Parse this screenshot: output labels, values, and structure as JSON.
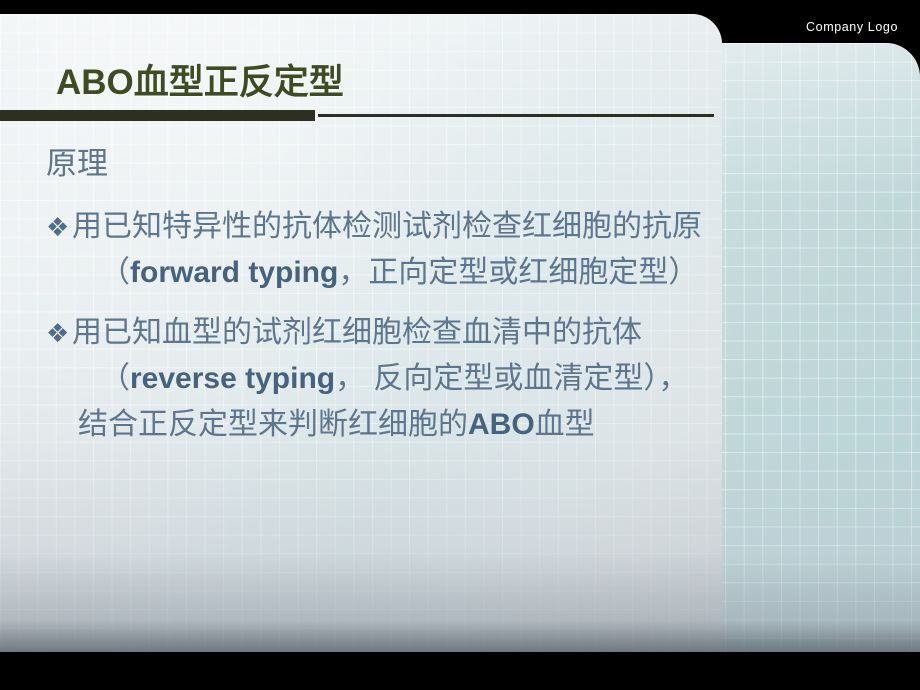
{
  "slide": {
    "logo_label": "Company Logo",
    "title": "ABO血型正反定型",
    "title_color": "#3f4c22",
    "rule_color": "#2d3021",
    "body_color": "#5d768f",
    "accent_color": "#45637f"
  },
  "body": {
    "heading": "原理",
    "bullets": [
      {
        "marker": "❖",
        "text": "用已知特异性的抗体检测试剂检查红细胞的抗原",
        "sub_open": "（",
        "sub_emphasis": "forward typing",
        "sub_rest": "，正向定型或红细胞定型）"
      },
      {
        "marker": "❖",
        "text": "用已知血型的试剂红细胞检查血清中的抗体",
        "sub_open": "（",
        "sub_emphasis": "reverse typing",
        "sub_rest": "， 反向定型或血清定型），"
      }
    ],
    "closing_prefix": "结合正反定型来判断红细胞的",
    "closing_emphasis": "ABO",
    "closing_suffix": "血型"
  }
}
